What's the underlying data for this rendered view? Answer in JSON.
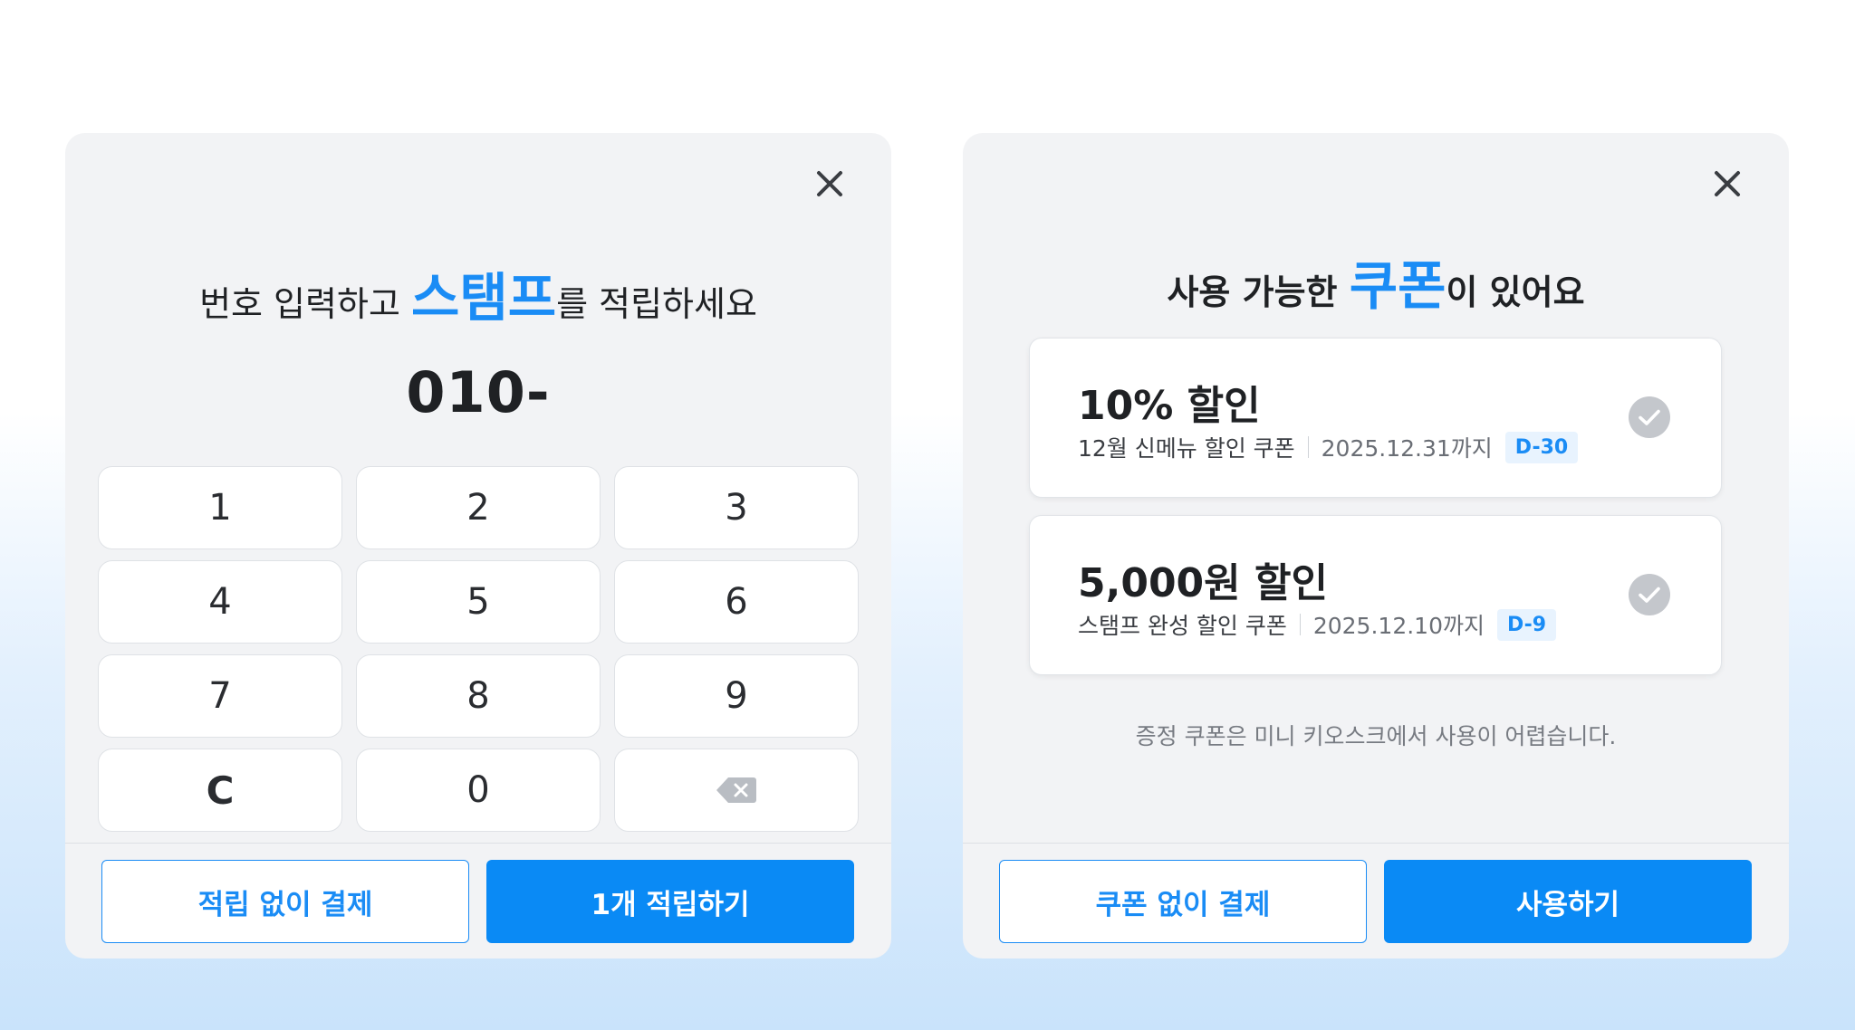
{
  "stamp_panel": {
    "title_prefix": "번호 입력하고 ",
    "title_highlight": "스탬프",
    "title_suffix": "를 적립하세요",
    "phone_value": "010-",
    "keys": [
      "1",
      "2",
      "3",
      "4",
      "5",
      "6",
      "7",
      "8",
      "9",
      "C",
      "0"
    ],
    "backspace_icon": "backspace-icon",
    "close_icon": "close-icon",
    "skip_button": "적립 없이 결제",
    "confirm_button": "1개 적립하기"
  },
  "coupon_panel": {
    "title_prefix": "사용 가능한 ",
    "title_highlight": "쿠폰",
    "title_suffix": "이 있어요",
    "close_icon": "close-icon",
    "coupons": [
      {
        "title": "10% 할인",
        "name": "12월 신메뉴 할인 쿠폰",
        "expiry": "2025.12.31까지",
        "dday": "D-30",
        "check_icon": "check-circle-icon"
      },
      {
        "title": "5,000원 할인",
        "name": "스탬프 완성 할인 쿠폰",
        "expiry": "2025.12.10까지",
        "dday": "D-9",
        "check_icon": "check-circle-icon"
      }
    ],
    "notice": "증정 쿠폰은 미니 키오스크에서 사용이 어렵습니다.",
    "skip_button": "쿠폰 없이 결제",
    "confirm_button": "사용하기"
  },
  "colors": {
    "accent": "#1a8cf5",
    "panel_bg": "#f2f3f5",
    "text": "#1f2124",
    "check_grey": "#c4c7cc"
  }
}
